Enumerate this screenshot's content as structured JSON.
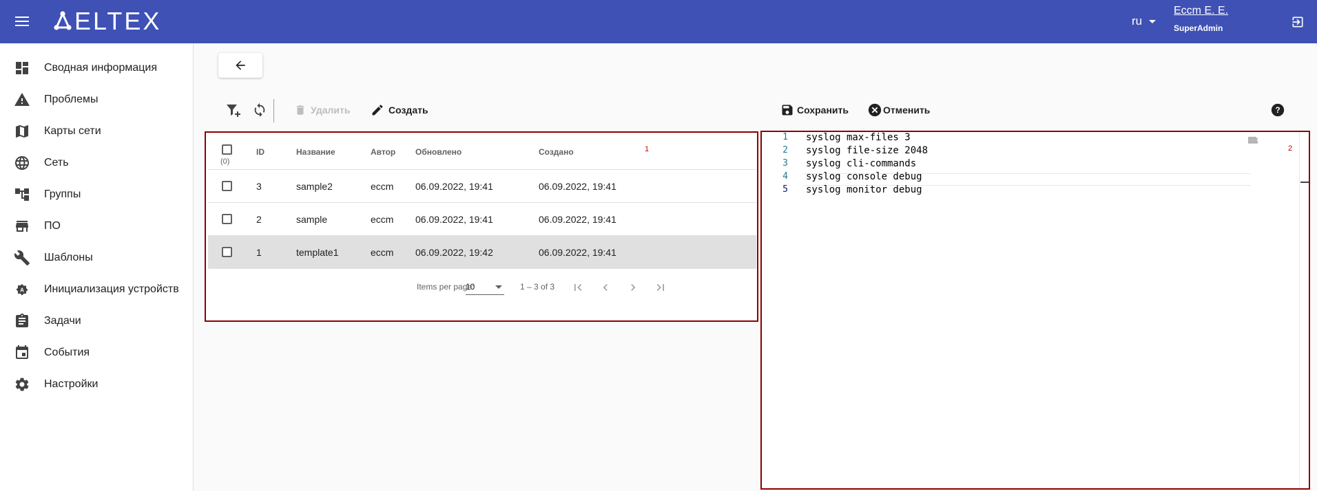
{
  "header": {
    "logo_text": "ELTEX",
    "language": "ru",
    "user_name": "Eccm E. E.",
    "user_role": "SuperAdmin",
    "bar_color": "#3f51b5"
  },
  "sidebar": {
    "items": [
      {
        "label": "Сводная информация",
        "icon": "dashboard-icon"
      },
      {
        "label": "Проблемы",
        "icon": "warning-icon"
      },
      {
        "label": "Карты сети",
        "icon": "map-icon"
      },
      {
        "label": "Сеть",
        "icon": "globe-icon"
      },
      {
        "label": "Группы",
        "icon": "account-tree-icon"
      },
      {
        "label": "ПО",
        "icon": "store-icon"
      },
      {
        "label": "Шаблоны",
        "icon": "wrench-icon"
      },
      {
        "label": "Инициализация устройств",
        "icon": "settings-a-icon"
      },
      {
        "label": "Задачи",
        "icon": "clipboard-icon"
      },
      {
        "label": "События",
        "icon": "calendar-icon"
      },
      {
        "label": "Настройки",
        "icon": "gear-icon"
      }
    ]
  },
  "toolbar": {
    "delete_label": "Удалить",
    "create_label": "Создать",
    "save_label": "Сохранить",
    "cancel_label": "Отменить"
  },
  "table": {
    "columns": [
      "ID",
      "Название",
      "Автор",
      "Обновлено",
      "Создано"
    ],
    "selected_count": "(0)",
    "marker": "1",
    "rows": [
      {
        "id": "3",
        "name": "sample2",
        "author": "eccm",
        "updated": "06.09.2022, 19:41",
        "created": "06.09.2022, 19:41"
      },
      {
        "id": "2",
        "name": "sample",
        "author": "eccm",
        "updated": "06.09.2022, 19:41",
        "created": "06.09.2022, 19:41"
      },
      {
        "id": "1",
        "name": "template1",
        "author": "eccm",
        "updated": "06.09.2022, 19:42",
        "created": "06.09.2022, 19:41"
      }
    ],
    "selected_row_index": 2,
    "paginator": {
      "items_per_page_label": "Items per page:",
      "items_per_page": "10",
      "range": "1 – 3 of 3"
    }
  },
  "editor": {
    "marker": "2",
    "lines": [
      {
        "n": "1",
        "text": "syslog max-files 3"
      },
      {
        "n": "2",
        "text": "syslog file-size 2048"
      },
      {
        "n": "3",
        "text": "syslog cli-commands"
      },
      {
        "n": "4",
        "text": "syslog console debug"
      },
      {
        "n": "5",
        "text": "syslog monitor debug"
      }
    ]
  }
}
